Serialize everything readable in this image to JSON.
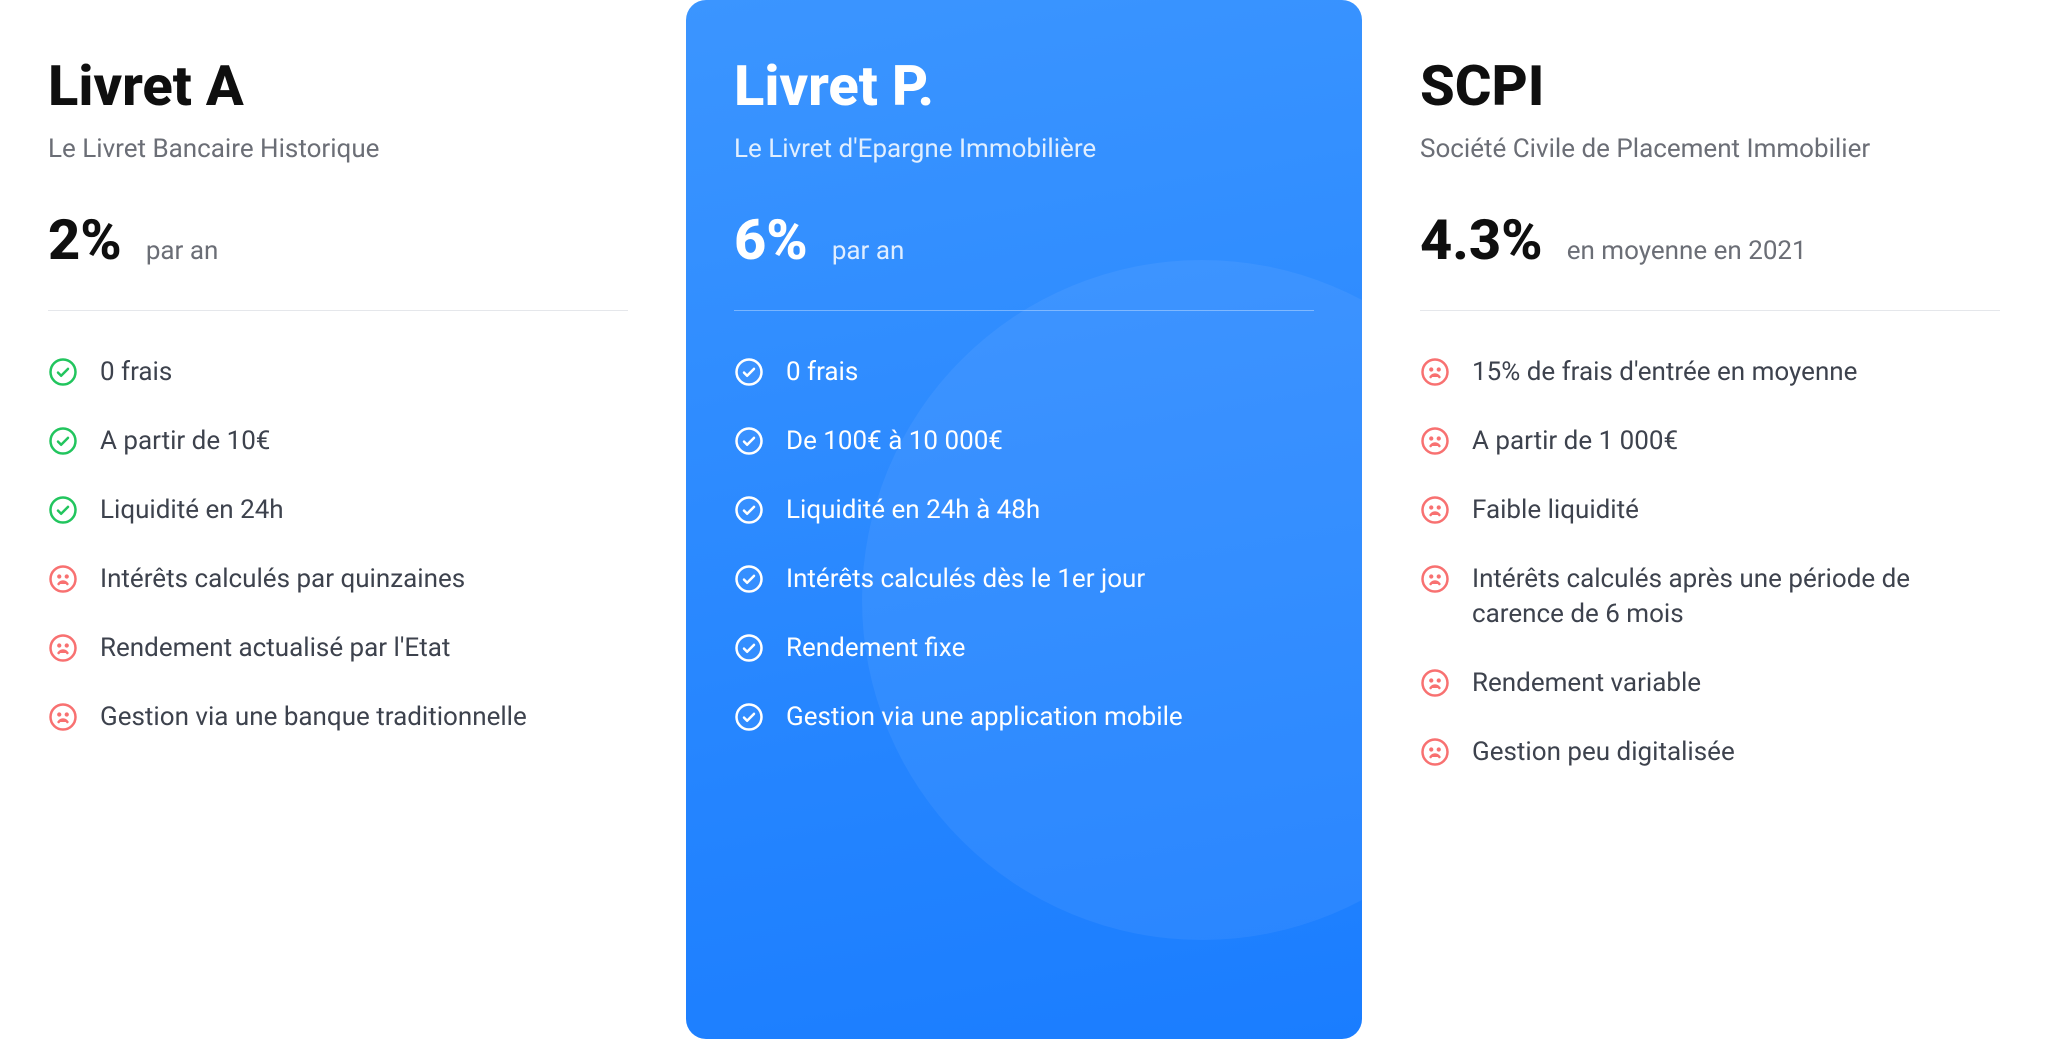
{
  "plans": [
    {
      "title": "Livret A",
      "subtitle": "Le Livret Bancaire Historique",
      "rate": "2%",
      "rate_unit": "par an",
      "featured": false,
      "features": [
        {
          "icon": "check-green",
          "text": "0 frais"
        },
        {
          "icon": "check-green",
          "text": "A partir de 10€"
        },
        {
          "icon": "check-green",
          "text": "Liquidité en 24h"
        },
        {
          "icon": "sad",
          "text": "Intérêts calculés par quinzaines"
        },
        {
          "icon": "sad",
          "text": "Rendement actualisé par l'Etat"
        },
        {
          "icon": "sad",
          "text": "Gestion via une banque traditionnelle"
        }
      ]
    },
    {
      "title": "Livret P.",
      "subtitle": "Le Livret d'Epargne Immobilière",
      "rate": "6%",
      "rate_unit": "par an",
      "featured": true,
      "features": [
        {
          "icon": "check-white",
          "text": "0 frais"
        },
        {
          "icon": "check-white",
          "text": "De 100€ à 10 000€"
        },
        {
          "icon": "check-white",
          "text": "Liquidité en 24h à 48h"
        },
        {
          "icon": "check-white",
          "text": "Intérêts calculés dès le 1er jour"
        },
        {
          "icon": "check-white",
          "text": "Rendement fixe"
        },
        {
          "icon": "check-white",
          "text": "Gestion via une application mobile"
        }
      ]
    },
    {
      "title": "SCPI",
      "subtitle": "Société Civile de Placement Immobilier",
      "rate": "4.3%",
      "rate_unit": "en moyenne en 2021",
      "featured": false,
      "features": [
        {
          "icon": "sad",
          "text": "15% de frais d'entrée en moyenne"
        },
        {
          "icon": "sad",
          "text": "A partir de 1 000€"
        },
        {
          "icon": "sad",
          "text": "Faible liquidité"
        },
        {
          "icon": "sad",
          "text": "Intérêts calculés après une période de carence de 6 mois"
        },
        {
          "icon": "sad",
          "text": "Rendement variable"
        },
        {
          "icon": "sad",
          "text": "Gestion peu digitalisée"
        }
      ]
    }
  ]
}
